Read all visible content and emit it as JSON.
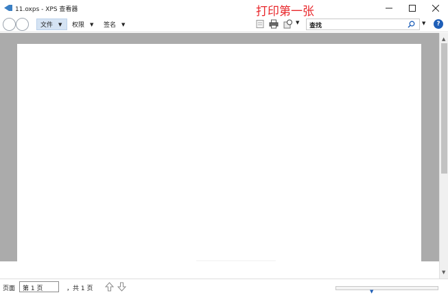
{
  "window": {
    "title": "11.oxps - XPS 查看器",
    "annotation": "打印第一张",
    "minimize_glyph": "—",
    "maximize_glyph": "☐",
    "close_glyph": "✕"
  },
  "toolbar": {
    "menus": [
      {
        "label": "文件",
        "caret": "▼"
      },
      {
        "label": "权限",
        "caret": "▼"
      },
      {
        "label": "签名",
        "caret": "▼"
      }
    ],
    "tool_caret": "▼",
    "search": {
      "label": "查找",
      "caret": "▼"
    },
    "help_glyph": "?"
  },
  "status": {
    "page_label": "页面",
    "page_value": "第 1 页",
    "page_total": "，共 1 页",
    "zoom_caret": "▼"
  },
  "scrollbar": {
    "up": "▲",
    "down": "▼"
  },
  "colors": {
    "accent": "#1f5fb8",
    "annotation": "#e8262a",
    "doc_background": "#ababab"
  }
}
